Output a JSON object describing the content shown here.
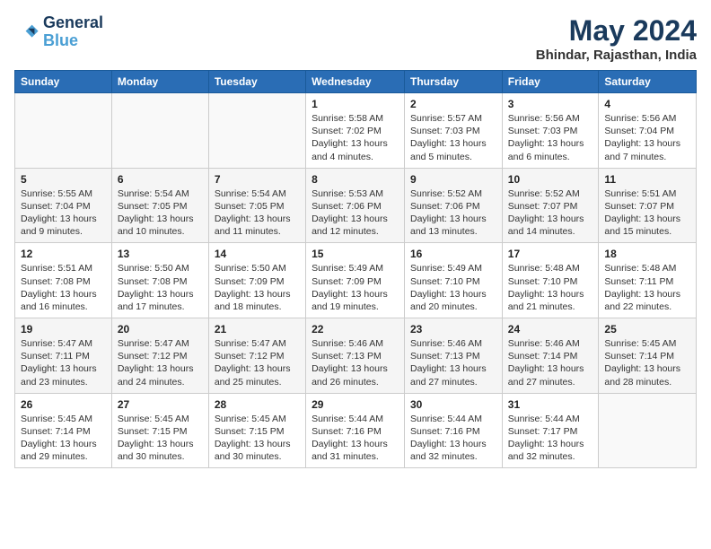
{
  "logo": {
    "line1": "General",
    "line2": "Blue"
  },
  "title": "May 2024",
  "subtitle": "Bhindar, Rajasthan, India",
  "weekdays": [
    "Sunday",
    "Monday",
    "Tuesday",
    "Wednesday",
    "Thursday",
    "Friday",
    "Saturday"
  ],
  "weeks": [
    [
      {
        "day": "",
        "text": ""
      },
      {
        "day": "",
        "text": ""
      },
      {
        "day": "",
        "text": ""
      },
      {
        "day": "1",
        "text": "Sunrise: 5:58 AM\nSunset: 7:02 PM\nDaylight: 13 hours\nand 4 minutes."
      },
      {
        "day": "2",
        "text": "Sunrise: 5:57 AM\nSunset: 7:03 PM\nDaylight: 13 hours\nand 5 minutes."
      },
      {
        "day": "3",
        "text": "Sunrise: 5:56 AM\nSunset: 7:03 PM\nDaylight: 13 hours\nand 6 minutes."
      },
      {
        "day": "4",
        "text": "Sunrise: 5:56 AM\nSunset: 7:04 PM\nDaylight: 13 hours\nand 7 minutes."
      }
    ],
    [
      {
        "day": "5",
        "text": "Sunrise: 5:55 AM\nSunset: 7:04 PM\nDaylight: 13 hours\nand 9 minutes."
      },
      {
        "day": "6",
        "text": "Sunrise: 5:54 AM\nSunset: 7:05 PM\nDaylight: 13 hours\nand 10 minutes."
      },
      {
        "day": "7",
        "text": "Sunrise: 5:54 AM\nSunset: 7:05 PM\nDaylight: 13 hours\nand 11 minutes."
      },
      {
        "day": "8",
        "text": "Sunrise: 5:53 AM\nSunset: 7:06 PM\nDaylight: 13 hours\nand 12 minutes."
      },
      {
        "day": "9",
        "text": "Sunrise: 5:52 AM\nSunset: 7:06 PM\nDaylight: 13 hours\nand 13 minutes."
      },
      {
        "day": "10",
        "text": "Sunrise: 5:52 AM\nSunset: 7:07 PM\nDaylight: 13 hours\nand 14 minutes."
      },
      {
        "day": "11",
        "text": "Sunrise: 5:51 AM\nSunset: 7:07 PM\nDaylight: 13 hours\nand 15 minutes."
      }
    ],
    [
      {
        "day": "12",
        "text": "Sunrise: 5:51 AM\nSunset: 7:08 PM\nDaylight: 13 hours\nand 16 minutes."
      },
      {
        "day": "13",
        "text": "Sunrise: 5:50 AM\nSunset: 7:08 PM\nDaylight: 13 hours\nand 17 minutes."
      },
      {
        "day": "14",
        "text": "Sunrise: 5:50 AM\nSunset: 7:09 PM\nDaylight: 13 hours\nand 18 minutes."
      },
      {
        "day": "15",
        "text": "Sunrise: 5:49 AM\nSunset: 7:09 PM\nDaylight: 13 hours\nand 19 minutes."
      },
      {
        "day": "16",
        "text": "Sunrise: 5:49 AM\nSunset: 7:10 PM\nDaylight: 13 hours\nand 20 minutes."
      },
      {
        "day": "17",
        "text": "Sunrise: 5:48 AM\nSunset: 7:10 PM\nDaylight: 13 hours\nand 21 minutes."
      },
      {
        "day": "18",
        "text": "Sunrise: 5:48 AM\nSunset: 7:11 PM\nDaylight: 13 hours\nand 22 minutes."
      }
    ],
    [
      {
        "day": "19",
        "text": "Sunrise: 5:47 AM\nSunset: 7:11 PM\nDaylight: 13 hours\nand 23 minutes."
      },
      {
        "day": "20",
        "text": "Sunrise: 5:47 AM\nSunset: 7:12 PM\nDaylight: 13 hours\nand 24 minutes."
      },
      {
        "day": "21",
        "text": "Sunrise: 5:47 AM\nSunset: 7:12 PM\nDaylight: 13 hours\nand 25 minutes."
      },
      {
        "day": "22",
        "text": "Sunrise: 5:46 AM\nSunset: 7:13 PM\nDaylight: 13 hours\nand 26 minutes."
      },
      {
        "day": "23",
        "text": "Sunrise: 5:46 AM\nSunset: 7:13 PM\nDaylight: 13 hours\nand 27 minutes."
      },
      {
        "day": "24",
        "text": "Sunrise: 5:46 AM\nSunset: 7:14 PM\nDaylight: 13 hours\nand 27 minutes."
      },
      {
        "day": "25",
        "text": "Sunrise: 5:45 AM\nSunset: 7:14 PM\nDaylight: 13 hours\nand 28 minutes."
      }
    ],
    [
      {
        "day": "26",
        "text": "Sunrise: 5:45 AM\nSunset: 7:14 PM\nDaylight: 13 hours\nand 29 minutes."
      },
      {
        "day": "27",
        "text": "Sunrise: 5:45 AM\nSunset: 7:15 PM\nDaylight: 13 hours\nand 30 minutes."
      },
      {
        "day": "28",
        "text": "Sunrise: 5:45 AM\nSunset: 7:15 PM\nDaylight: 13 hours\nand 30 minutes."
      },
      {
        "day": "29",
        "text": "Sunrise: 5:44 AM\nSunset: 7:16 PM\nDaylight: 13 hours\nand 31 minutes."
      },
      {
        "day": "30",
        "text": "Sunrise: 5:44 AM\nSunset: 7:16 PM\nDaylight: 13 hours\nand 32 minutes."
      },
      {
        "day": "31",
        "text": "Sunrise: 5:44 AM\nSunset: 7:17 PM\nDaylight: 13 hours\nand 32 minutes."
      },
      {
        "day": "",
        "text": ""
      }
    ]
  ]
}
